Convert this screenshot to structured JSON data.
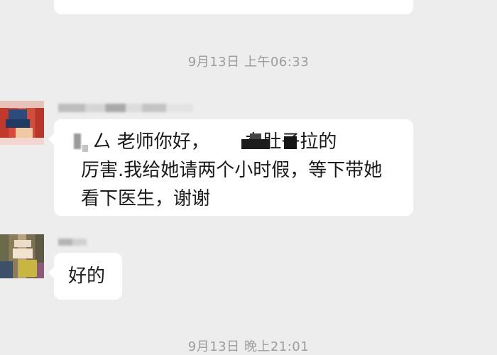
{
  "timestamps": [
    "9月13日 上午06:33",
    "9月13日 晚上21:01"
  ],
  "messages": [
    {
      "lines": [
        "  厶 老师你好，      立肚子拉的",
        "厉害.我给她请两个小时假，等下带她",
        "看下医生，谢谢"
      ]
    },
    {
      "lines": [
        "好的"
      ]
    }
  ]
}
